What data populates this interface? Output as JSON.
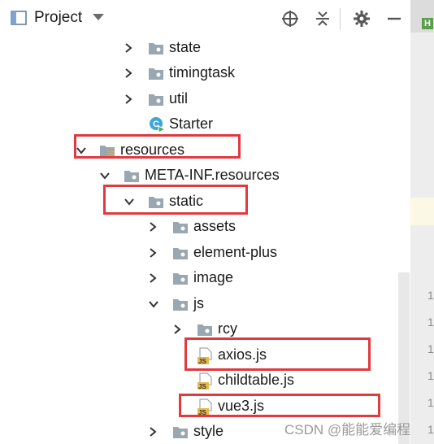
{
  "header": {
    "title": "Project",
    "icons": [
      "project-folder-icon",
      "crosshair-icon",
      "collapse-all-icon",
      "gear-icon",
      "minimize-icon"
    ]
  },
  "colors": {
    "highlight": "#e03a3e",
    "folder": "#9aa7b0",
    "js_badge": "#e8b84a"
  },
  "tree": [
    {
      "label": "state",
      "icon": "folder-icon",
      "chevron": "right"
    },
    {
      "label": "timingtask",
      "icon": "folder-icon",
      "chevron": "right"
    },
    {
      "label": "util",
      "icon": "folder-icon",
      "chevron": "right"
    },
    {
      "label": "Starter",
      "icon": "java-class-icon",
      "chevron": "none"
    },
    {
      "label": "resources",
      "icon": "resources-folder-icon",
      "chevron": "down"
    },
    {
      "label": "META-INF.resources",
      "icon": "folder-icon",
      "chevron": "down"
    },
    {
      "label": "static",
      "icon": "folder-icon",
      "chevron": "down"
    },
    {
      "label": "assets",
      "icon": "folder-icon",
      "chevron": "right"
    },
    {
      "label": "element-plus",
      "icon": "folder-icon",
      "chevron": "right"
    },
    {
      "label": "image",
      "icon": "folder-icon",
      "chevron": "right"
    },
    {
      "label": "js",
      "icon": "folder-icon",
      "chevron": "down"
    },
    {
      "label": "rcy",
      "icon": "folder-icon",
      "chevron": "right"
    },
    {
      "label": "axios.js",
      "icon": "js-file-icon",
      "chevron": "none"
    },
    {
      "label": "childtable.js",
      "icon": "js-file-icon",
      "chevron": "none"
    },
    {
      "label": "vue3.js",
      "icon": "js-file-icon",
      "chevron": "none"
    },
    {
      "label": "style",
      "icon": "folder-icon",
      "chevron": "right"
    }
  ],
  "editor_gutter": {
    "tab_letter": "H",
    "line_numbers": [
      "1",
      "1",
      "1",
      "1",
      "1",
      "1"
    ]
  },
  "watermark": "CSDN @能能爱编程"
}
